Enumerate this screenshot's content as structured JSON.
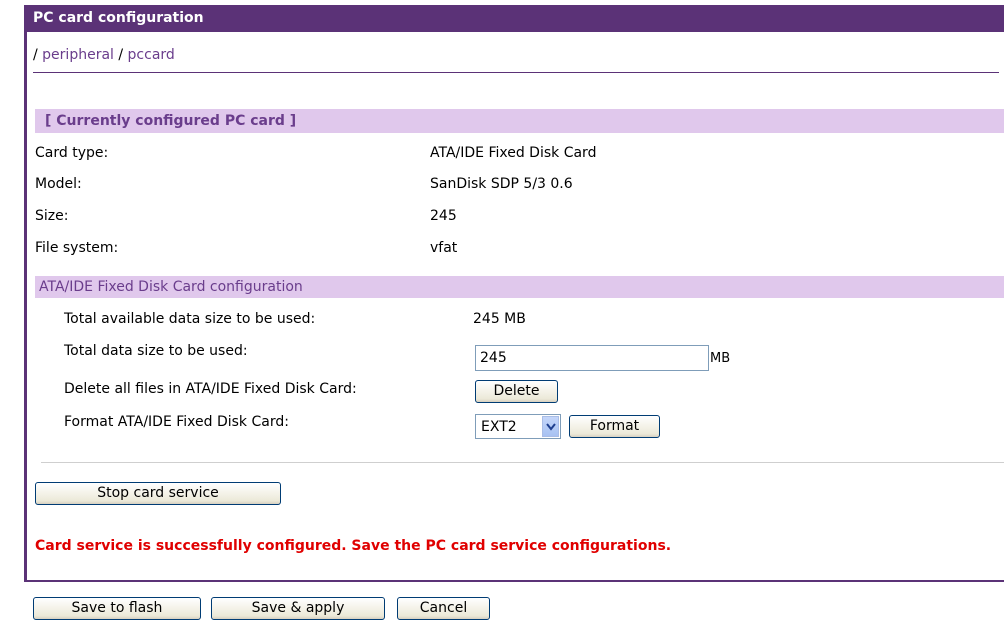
{
  "window": {
    "title": "PC card configuration"
  },
  "breadcrumb": {
    "sep1": "/",
    "item1": "peripheral",
    "sep2": "/",
    "item2": "pccard"
  },
  "current_card": {
    "header": "[ Currently configured PC card ]",
    "rows": [
      {
        "label": "Card type:",
        "value": "ATA/IDE Fixed Disk Card"
      },
      {
        "label": "Model:",
        "value": "SanDisk SDP 5/3 0.6"
      },
      {
        "label": "Size:",
        "value": "245"
      },
      {
        "label": "File system:",
        "value": "vfat"
      }
    ]
  },
  "config": {
    "header": "ATA/IDE Fixed Disk Card configuration",
    "available_label": "Total available data size to be used:",
    "available_value": "245 MB",
    "used_label": "Total data size to be used:",
    "used_value": "245",
    "used_unit": "MB",
    "delete_label": "Delete all files in ATA/IDE Fixed Disk Card:",
    "delete_button": "Delete",
    "format_label": "Format ATA/IDE Fixed Disk Card:",
    "format_selected": "EXT2",
    "format_button": "Format"
  },
  "stop_button": "Stop card service",
  "status_message": "Card service is successfully configured. Save the PC card service configurations.",
  "footer": {
    "save_flash": "Save to flash",
    "save_apply": "Save & apply",
    "cancel": "Cancel"
  },
  "colors": {
    "title_bar": "#5b3277",
    "section_bg": "#e0c8ec",
    "link": "#6a3d8c",
    "status": "#e00000"
  }
}
